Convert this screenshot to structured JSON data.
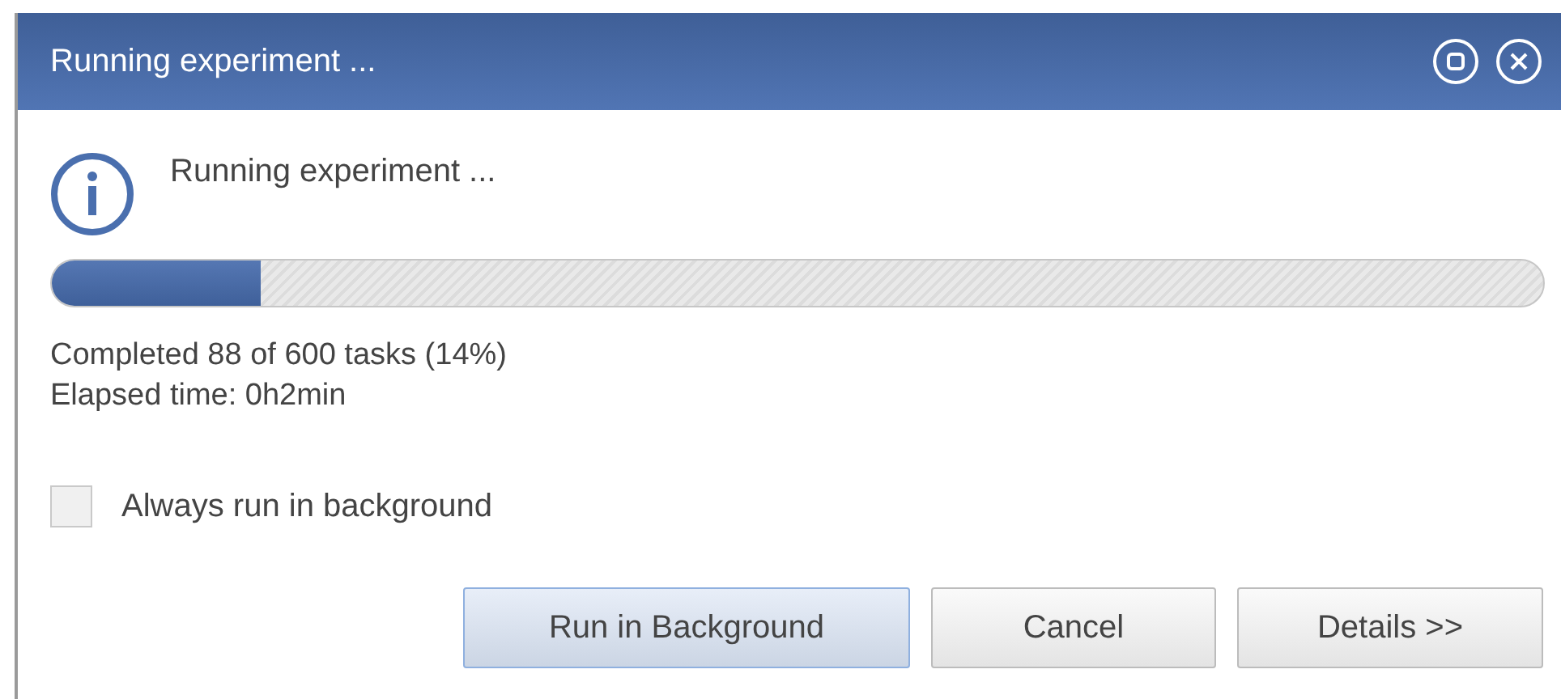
{
  "window": {
    "title": "Running experiment ..."
  },
  "message": "Running experiment ...",
  "progress": {
    "level": 0.14
  },
  "status_lines": [
    "Completed 88 of 600 tasks (14%)",
    "Elapsed time: 0h2min"
  ],
  "option": {
    "label": "Always run in background",
    "checked": false
  },
  "buttons": [
    {
      "label": "Run in Background",
      "default": true
    },
    {
      "label": "Cancel",
      "default": false
    },
    {
      "label": "Details >>",
      "default": false
    }
  ]
}
